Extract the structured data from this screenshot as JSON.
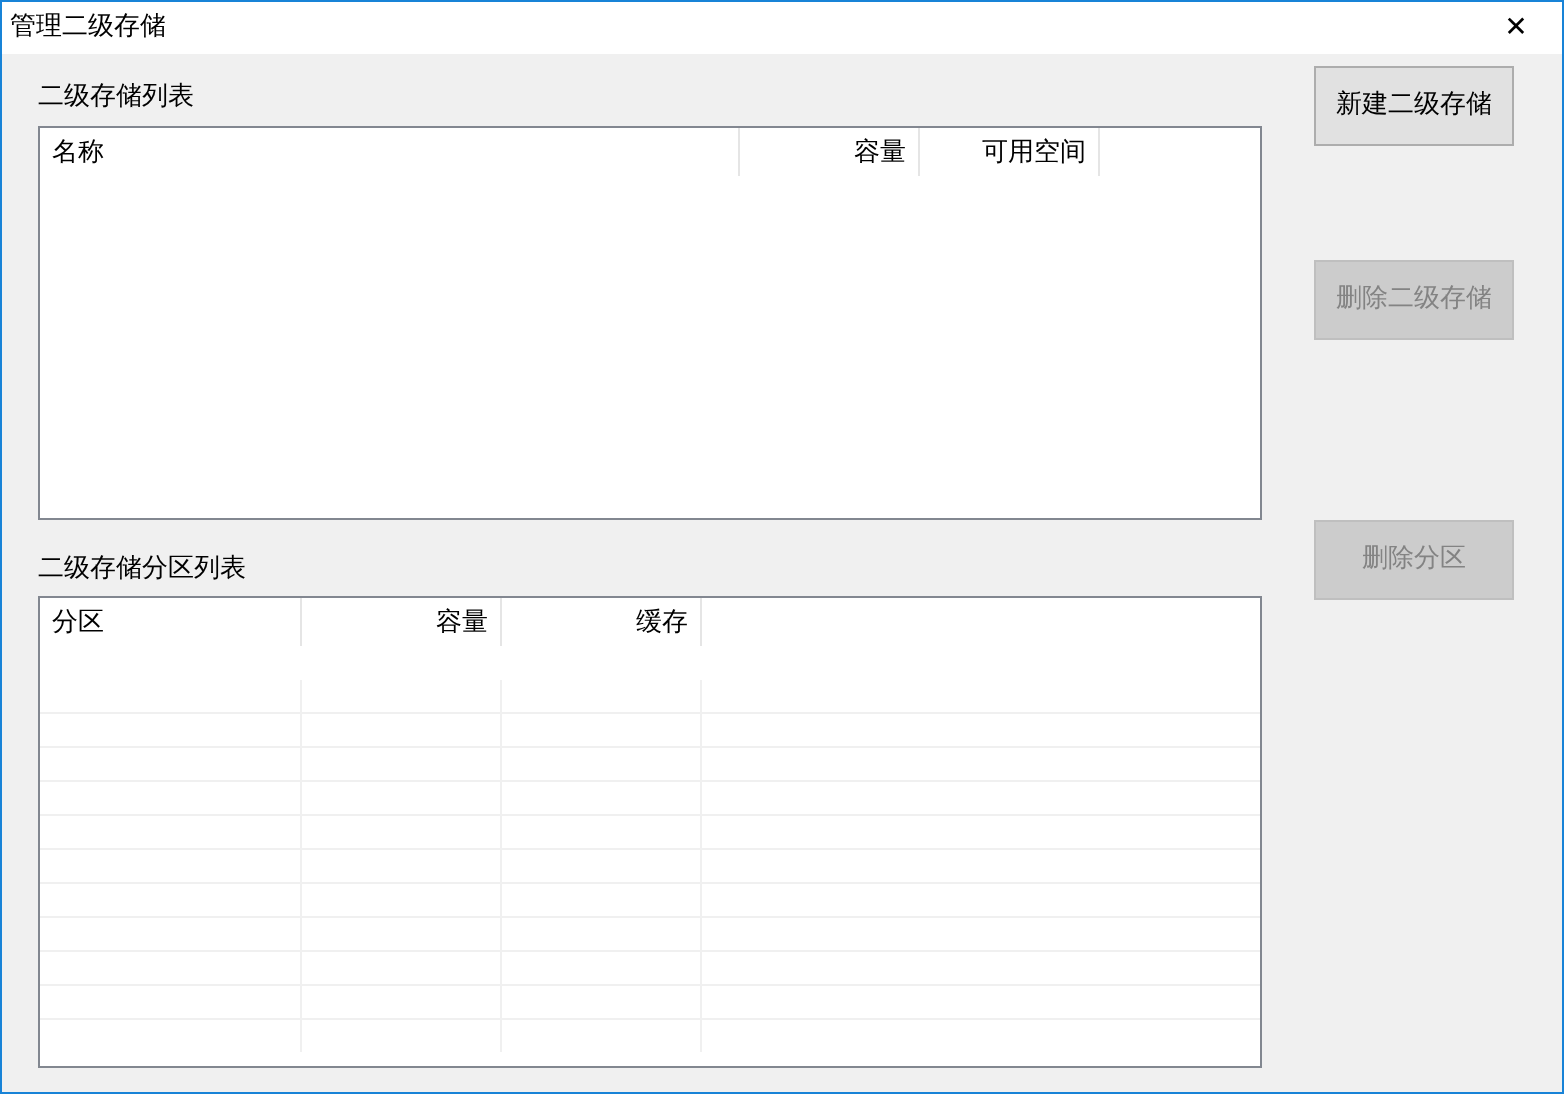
{
  "window": {
    "title": "管理二级存储",
    "close": "✕"
  },
  "storage_list": {
    "label": "二级存储列表",
    "columns": [
      "名称",
      "容量",
      "可用空间"
    ]
  },
  "partition_list": {
    "label": "二级存储分区列表",
    "columns": [
      "分区",
      "容量",
      "缓存"
    ]
  },
  "buttons": [
    {
      "label": "新建二级存储",
      "disabled": false
    },
    {
      "label": "删除二级存储",
      "disabled": true
    },
    {
      "label": "删除分区",
      "disabled": true
    }
  ]
}
